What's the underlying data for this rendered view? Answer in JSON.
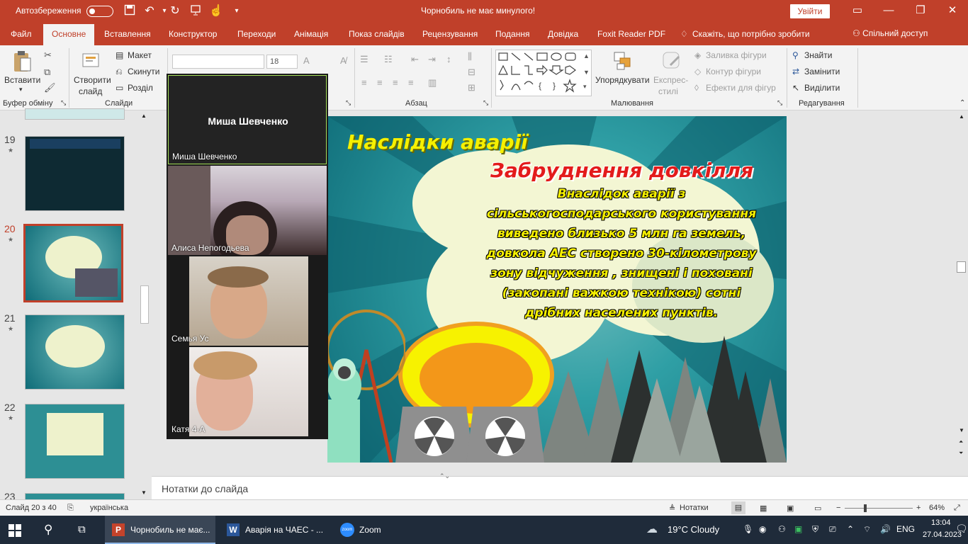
{
  "titlebar": {
    "autosave_label": "Автозбереження",
    "doc_title": "Чорнобиль не має минулого!",
    "signin": "Увійти",
    "icons": [
      "save-icon",
      "undo-icon",
      "redo-icon",
      "present-icon",
      "touch-icon",
      "customize-icon"
    ]
  },
  "tabs": [
    "Файл",
    "Основне",
    "Вставлення",
    "Конструктор",
    "Переходи",
    "Анімація",
    "Показ слайдів",
    "Рецензування",
    "Подання",
    "Довідка",
    "Foxit Reader PDF",
    "Скажіть, що потрібно зробити"
  ],
  "share_label": "Спільний доступ",
  "ribbon": {
    "clipboard": {
      "paste": "Вставити",
      "group": "Буфер обміну"
    },
    "slides": {
      "new_slide_1": "Створити",
      "new_slide_2": "слайд",
      "layout": "Макет",
      "reset": "Скинути",
      "section": "Розділ",
      "group": "Слайди"
    },
    "font": {
      "size": "18"
    },
    "paragraph": {
      "group": "Абзац"
    },
    "drawing": {
      "arrange": "Упорядкувати",
      "styles_1": "Експрес-",
      "styles_2": "стилі",
      "fill": "Заливка фігури",
      "outline": "Контур фігури",
      "effects": "Ефекти для фігур",
      "group": "Малювання"
    },
    "editing": {
      "find": "Знайти",
      "replace": "Замінити",
      "select": "Виділити",
      "group": "Редагування"
    }
  },
  "thumbnails": [
    {
      "num": "19",
      "star": "★"
    },
    {
      "num": "20",
      "star": "★"
    },
    {
      "num": "21",
      "star": "★"
    },
    {
      "num": "22",
      "star": "★"
    },
    {
      "num": "23",
      "star": ""
    }
  ],
  "slide": {
    "heading": "Наслідки аварії",
    "subheading": "Забруднення довкілля",
    "body": "Внаслідок аварії з сільськогосподарського користування виведено близько 5 млн га земель, довкола АЕС створено 30-кілометрову зону відчуження , знищені і поховані (закопані важкою технікою) сотні дрібних населених пунктів."
  },
  "zoom_tiles": [
    {
      "center_name": "Миша Шевченко",
      "label": "Миша Шевченко"
    },
    {
      "label": "Алиса Непогодьева"
    },
    {
      "label": "Семья Ус"
    },
    {
      "label": "Катя  4-А"
    }
  ],
  "notes_placeholder": "Нотатки до слайда",
  "status": {
    "slide_info": "Слайд 20 з 40",
    "language": "українська",
    "notes_btn": "Нотатки",
    "zoom": "64%"
  },
  "taskbar": {
    "apps": [
      {
        "label": "Чорнобиль не має..."
      },
      {
        "label": "Аварія на ЧАЕС - ..."
      },
      {
        "label": "Zoom"
      }
    ],
    "weather": "19°C  Cloudy",
    "lang": "ENG",
    "time": "13:04",
    "date": "27.04.2023"
  },
  "colors": {
    "accent": "#c0402a",
    "slide_heading": "#f6f000",
    "slide_sub": "#e31b1b"
  }
}
